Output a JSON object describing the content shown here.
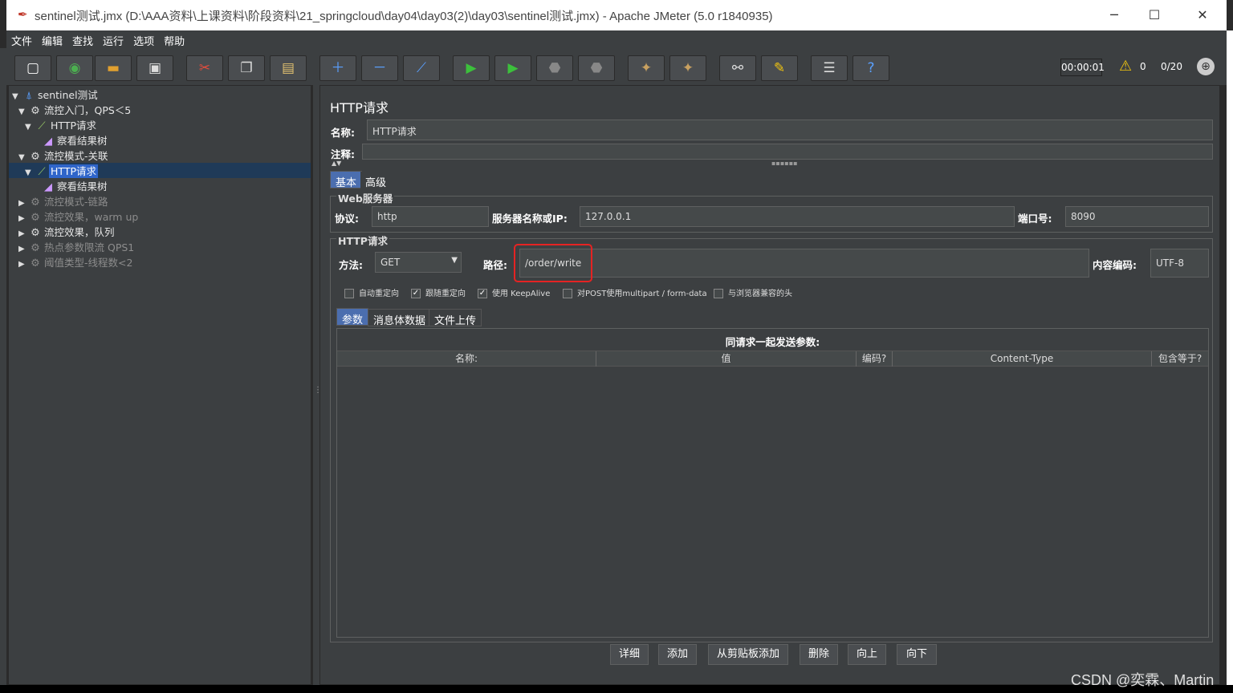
{
  "window": {
    "title": "sentinel测试.jmx (D:\\AAA资料\\上课资料\\阶段资料\\21_springcloud\\day04\\day03(2)\\day03\\sentinel测试.jmx) - Apache JMeter (5.0 r1840935)"
  },
  "menu": [
    "文件",
    "编辑",
    "查找",
    "运行",
    "选项",
    "帮助"
  ],
  "toolbar": {
    "timer": "00:00:01",
    "warnings": "0",
    "threads": "0/20"
  },
  "tree": [
    {
      "label": "sentinel测试"
    },
    {
      "label": "流控入门，QPS＜5"
    },
    {
      "label": "HTTP请求"
    },
    {
      "label": "察看结果树"
    },
    {
      "label": "流控模式-关联"
    },
    {
      "label": "HTTP请求"
    },
    {
      "label": "察看结果树"
    },
    {
      "label": "流控模式-链路"
    },
    {
      "label": "流控效果，warm up"
    },
    {
      "label": "流控效果，队列"
    },
    {
      "label": "热点参数限流 QPS1"
    },
    {
      "label": "阈值类型-线程数<2"
    }
  ],
  "panel": {
    "title": "HTTP请求",
    "name_label": "名称:",
    "name_value": "HTTP请求",
    "comment_label": "注释:",
    "comment_value": "",
    "tabs": [
      "基本",
      "高级"
    ],
    "web_group": "Web服务器",
    "protocol_label": "协议:",
    "protocol_value": "http",
    "server_label": "服务器名称或IP:",
    "server_value": "127.0.0.1",
    "port_label": "端口号:",
    "port_value": "8090",
    "http_group": "HTTP请求",
    "method_label": "方法:",
    "method_value": "GET",
    "path_label": "路径:",
    "path_value": "/order/write",
    "encoding_label": "内容编码:",
    "encoding_value": "UTF-8",
    "checkboxes": [
      {
        "label": "自动重定向",
        "checked": false
      },
      {
        "label": "跟随重定向",
        "checked": true
      },
      {
        "label": "使用 KeepAlive",
        "checked": true
      },
      {
        "label": "对POST使用multipart / form-data",
        "checked": false
      },
      {
        "label": "与浏览器兼容的头",
        "checked": false
      }
    ],
    "sub_tabs": [
      "参数",
      "消息体数据",
      "文件上传"
    ],
    "params_caption": "同请求一起发送参数:",
    "columns": [
      "名称:",
      "值",
      "编码?",
      "Content-Type",
      "包含等于?"
    ],
    "buttons": [
      "详细",
      "添加",
      "从剪贴板添加",
      "删除",
      "向上",
      "向下"
    ]
  },
  "watermark": "CSDN @奕霖、Martin"
}
